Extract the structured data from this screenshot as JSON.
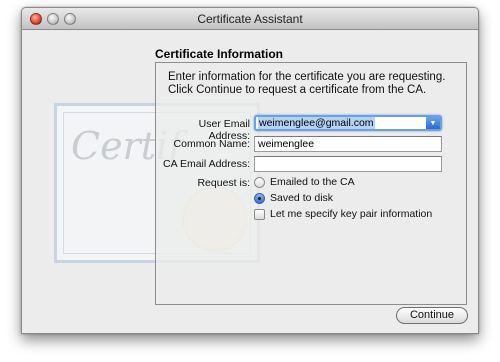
{
  "window": {
    "title": "Certificate Assistant"
  },
  "background_art": {
    "word": "Certif"
  },
  "section": {
    "title": "Certificate Information"
  },
  "intro": "Enter information for the certificate you are requesting. Click Continue to request a certificate from the CA.",
  "form": {
    "user_email_label": "User Email Address:",
    "user_email_value": "weimenglee@gmail.com",
    "common_name_label": "Common Name:",
    "common_name_value": "weimenglee",
    "ca_email_label": "CA Email Address:",
    "ca_email_value": "",
    "request_label": "Request is:",
    "options": [
      {
        "label": "Emailed to the CA",
        "selected": false
      },
      {
        "label": "Saved to disk",
        "selected": true
      }
    ],
    "key_pair_label": "Let me specify key pair information",
    "key_pair_checked": false
  },
  "buttons": {
    "continue": "Continue"
  },
  "icons": {
    "dropdown": "chevron-down-icon"
  },
  "colors": {
    "focus": "#6ea0dd",
    "selection": "#b5d2f5",
    "close": "#e0442f"
  }
}
